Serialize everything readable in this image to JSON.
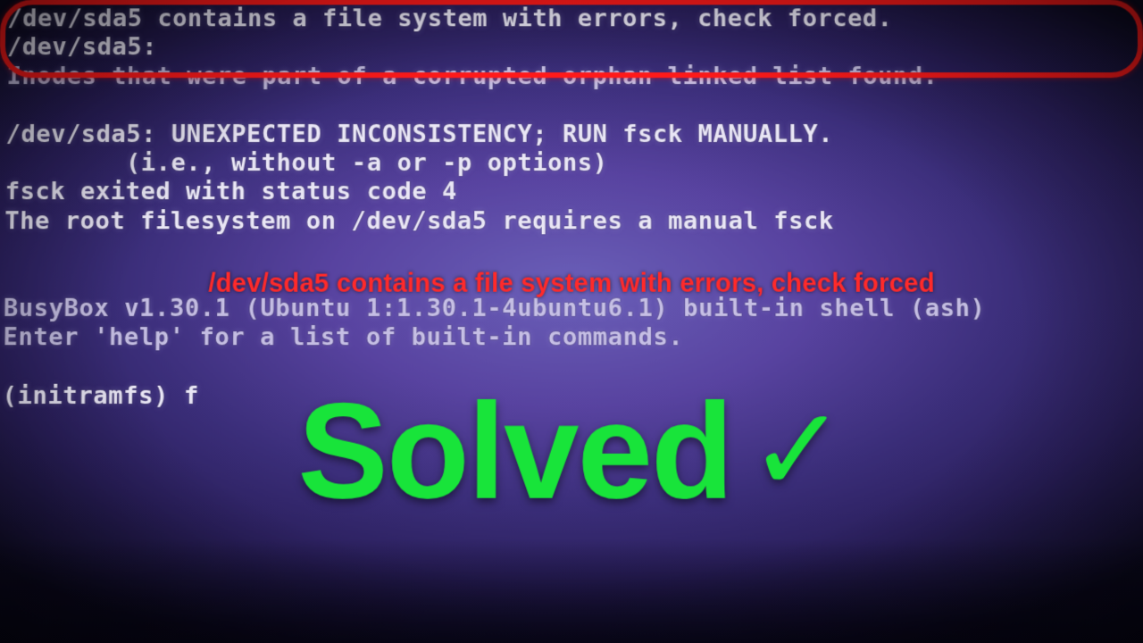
{
  "console": {
    "l1": "/dev/sda5 contains a file system with errors, check forced.",
    "l2": "/dev/sda5:",
    "l3": "Inodes that were part of a corrupted orphan linked list found.",
    "l4": "",
    "l5": "/dev/sda5: UNEXPECTED INCONSISTENCY; RUN fsck MANUALLY.",
    "l6": "        (i.e., without -a or -p options)",
    "l7": "fsck exited with status code 4",
    "l8": "The root filesystem on /dev/sda5 requires a manual fsck",
    "l9": "",
    "l10": "",
    "l11": "BusyBox v1.30.1 (Ubuntu 1:1.30.1-4ubuntu6.1) built-in shell (ash)",
    "l12": "Enter 'help' for a list of built-in commands.",
    "l13": "",
    "l14": "(initramfs) f"
  },
  "overlay": {
    "red_caption": "/dev/sda5 contains a file system with errors, check forced",
    "solved_text": "Solved",
    "check_mark": "✓"
  }
}
